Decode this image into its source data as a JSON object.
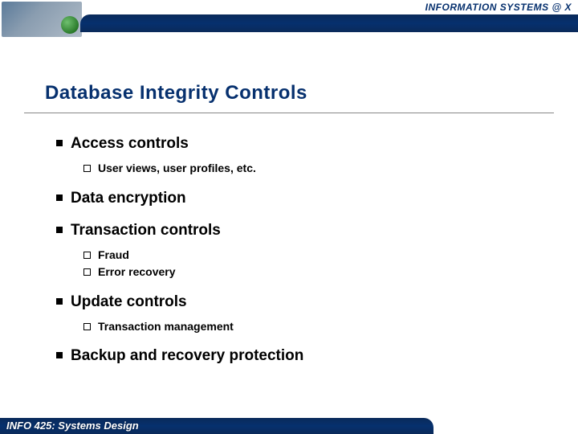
{
  "header": {
    "tag": "INFORMATION SYSTEMS @ X"
  },
  "title": "Database Integrity Controls",
  "bullets": {
    "b1": "Access controls",
    "b1_1": "User views, user profiles, etc.",
    "b2": "Data encryption",
    "b3": "Transaction controls",
    "b3_1": "Fraud",
    "b3_2": "Error recovery",
    "b4": "Update controls",
    "b4_1": "Transaction management",
    "b5": "Backup and recovery protection"
  },
  "footer": {
    "text": "INFO 425: Systems Design"
  }
}
